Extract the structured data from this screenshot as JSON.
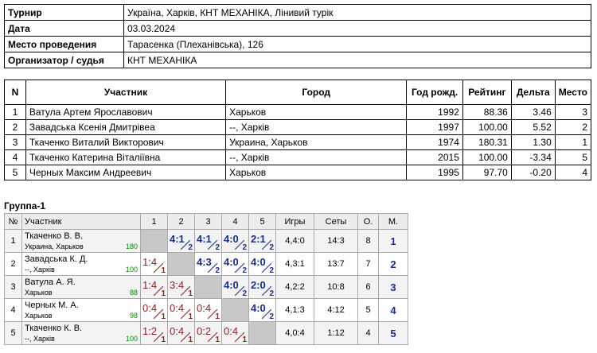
{
  "info": {
    "rows": [
      {
        "label": "Турнир",
        "value": "Україна, Харків, КНТ МЕХАНІКА, Лінивий турік"
      },
      {
        "label": "Дата",
        "value": "03.03.2024"
      },
      {
        "label": "Место проведения",
        "value": "Тарасенка (Плеханівська), 126"
      },
      {
        "label": "Организатор / судья",
        "value": " КНТ МЕХАНІКА"
      }
    ]
  },
  "participants": {
    "headers": {
      "n": "N",
      "name": "Участник",
      "city": "Город",
      "year": "Год рожд.",
      "rating": "Рейтинг",
      "delta": "Дельта",
      "place": "Место"
    },
    "rows": [
      {
        "n": "1",
        "name": "Ватула Артем Ярославович",
        "city": "Харьков",
        "year": "1992",
        "rating": "88.36",
        "delta": "3.46",
        "place": "3"
      },
      {
        "n": "2",
        "name": "Завадська Ксенія Дмитрівеа",
        "city": "--, Харків",
        "year": "1997",
        "rating": "100.00",
        "delta": "5.52",
        "place": "2"
      },
      {
        "n": "3",
        "name": "Ткаченко Виталий Викторович",
        "city": "Украина, Харьков",
        "year": "1974",
        "rating": "180.31",
        "delta": "1.30",
        "place": "1"
      },
      {
        "n": "4",
        "name": "Ткаченко Катерина Віталіївна",
        "city": "--, Харків",
        "year": "2015",
        "rating": "100.00",
        "delta": "-3.34",
        "place": "5"
      },
      {
        "n": "5",
        "name": "Черных Максим Андреевич",
        "city": "Харьков",
        "year": "1995",
        "rating": "97.70",
        "delta": "-0.20",
        "place": "4"
      }
    ]
  },
  "group": {
    "title": "Группа-1",
    "headers": {
      "n": "№",
      "name": "Участник",
      "cols": [
        "1",
        "2",
        "3",
        "4",
        "5"
      ],
      "games": "Игры",
      "sets": "Сеты",
      "o": "О.",
      "m": "М."
    },
    "rows": [
      {
        "n": "1",
        "name": "Ткаченко В. В.",
        "city": "Украина, Харьков",
        "rating": "180",
        "cells": [
          null,
          {
            "s": "4:1",
            "p": "2",
            "w": true
          },
          {
            "s": "4:1",
            "p": "2",
            "w": true
          },
          {
            "s": "4:0",
            "p": "2",
            "w": true
          },
          {
            "s": "2:1",
            "p": "2",
            "w": true
          }
        ],
        "games": "4,4:0",
        "sets": "14:3",
        "o": "8",
        "m": "1"
      },
      {
        "n": "2",
        "name": "Завадська К. Д.",
        "city": "--, Харків",
        "rating": "100",
        "cells": [
          {
            "s": "1:4",
            "p": "1",
            "w": false
          },
          null,
          {
            "s": "4:3",
            "p": "2",
            "w": true
          },
          {
            "s": "4:0",
            "p": "2",
            "w": true
          },
          {
            "s": "4:0",
            "p": "2",
            "w": true
          }
        ],
        "games": "4,3:1",
        "sets": "13:7",
        "o": "7",
        "m": "2"
      },
      {
        "n": "3",
        "name": "Ватула А. Я.",
        "city": "Харьков",
        "rating": "88",
        "cells": [
          {
            "s": "1:4",
            "p": "1",
            "w": false
          },
          {
            "s": "3:4",
            "p": "1",
            "w": false
          },
          null,
          {
            "s": "4:0",
            "p": "2",
            "w": true
          },
          {
            "s": "2:0",
            "p": "2",
            "w": true
          }
        ],
        "games": "4,2:2",
        "sets": "10:8",
        "o": "6",
        "m": "3"
      },
      {
        "n": "4",
        "name": "Черных М. А.",
        "city": "Харьков",
        "rating": "98",
        "cells": [
          {
            "s": "0:4",
            "p": "1",
            "w": false
          },
          {
            "s": "0:4",
            "p": "1",
            "w": false
          },
          {
            "s": "0:4",
            "p": "1",
            "w": false
          },
          null,
          {
            "s": "4:0",
            "p": "2",
            "w": true
          }
        ],
        "games": "4,1:3",
        "sets": "4:12",
        "o": "5",
        "m": "4"
      },
      {
        "n": "5",
        "name": "Ткаченко К. В.",
        "city": "--, Харків",
        "rating": "100",
        "cells": [
          {
            "s": "1:2",
            "p": "1",
            "w": false
          },
          {
            "s": "0:4",
            "p": "1",
            "w": false
          },
          {
            "s": "0:2",
            "p": "1",
            "w": false
          },
          {
            "s": "0:4",
            "p": "1",
            "w": false
          },
          null
        ],
        "games": "4,0:4",
        "sets": "1:12",
        "o": "4",
        "m": "5"
      }
    ]
  },
  "colors": {
    "win": "#1a2f8a",
    "loss": "#8b1f1f",
    "rating": "#008800"
  }
}
